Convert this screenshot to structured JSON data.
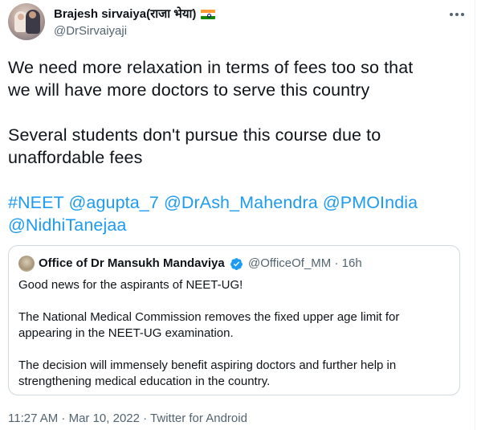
{
  "author": {
    "display_name": "Brajesh sirvaiya(राजा भेया)",
    "flag_icon": "india-flag-icon",
    "handle": "@DrSirvaiyaji"
  },
  "tweet": {
    "line1": "We need more relaxation in terms of fees too so that",
    "line2": "we will have more doctors to serve this country",
    "line3": "Several students don't pursue this course due to",
    "line4": "unaffordable fees",
    "tags_line1": "#NEET @agupta_7 @DrAsh_Mahendra @PMOIndia",
    "tags_line2": "@NidhiTanejaa"
  },
  "quote": {
    "display_name": "Office of Dr Mansukh Mandaviya",
    "verified_icon": "verified-badge-icon",
    "handle_time": "@OfficeOf_MM · 16h",
    "text_1": "Good news for the aspirants of NEET-UG!",
    "text_2": "The National Medical Commission removes the fixed upper age limit for",
    "text_3": "appearing in the NEET-UG examination.",
    "text_4": "The decision will immensely benefit aspiring doctors and further help in",
    "text_5": "strengthening medical education in the country."
  },
  "meta": {
    "timestamp_source": "11:27 AM · Mar 10, 2022 · Twitter for Android"
  },
  "colors": {
    "text": "#0f1419",
    "secondary": "#536471",
    "link": "#1d9bf0",
    "border": "#cfd9de"
  },
  "more_icon": "more-options-icon"
}
